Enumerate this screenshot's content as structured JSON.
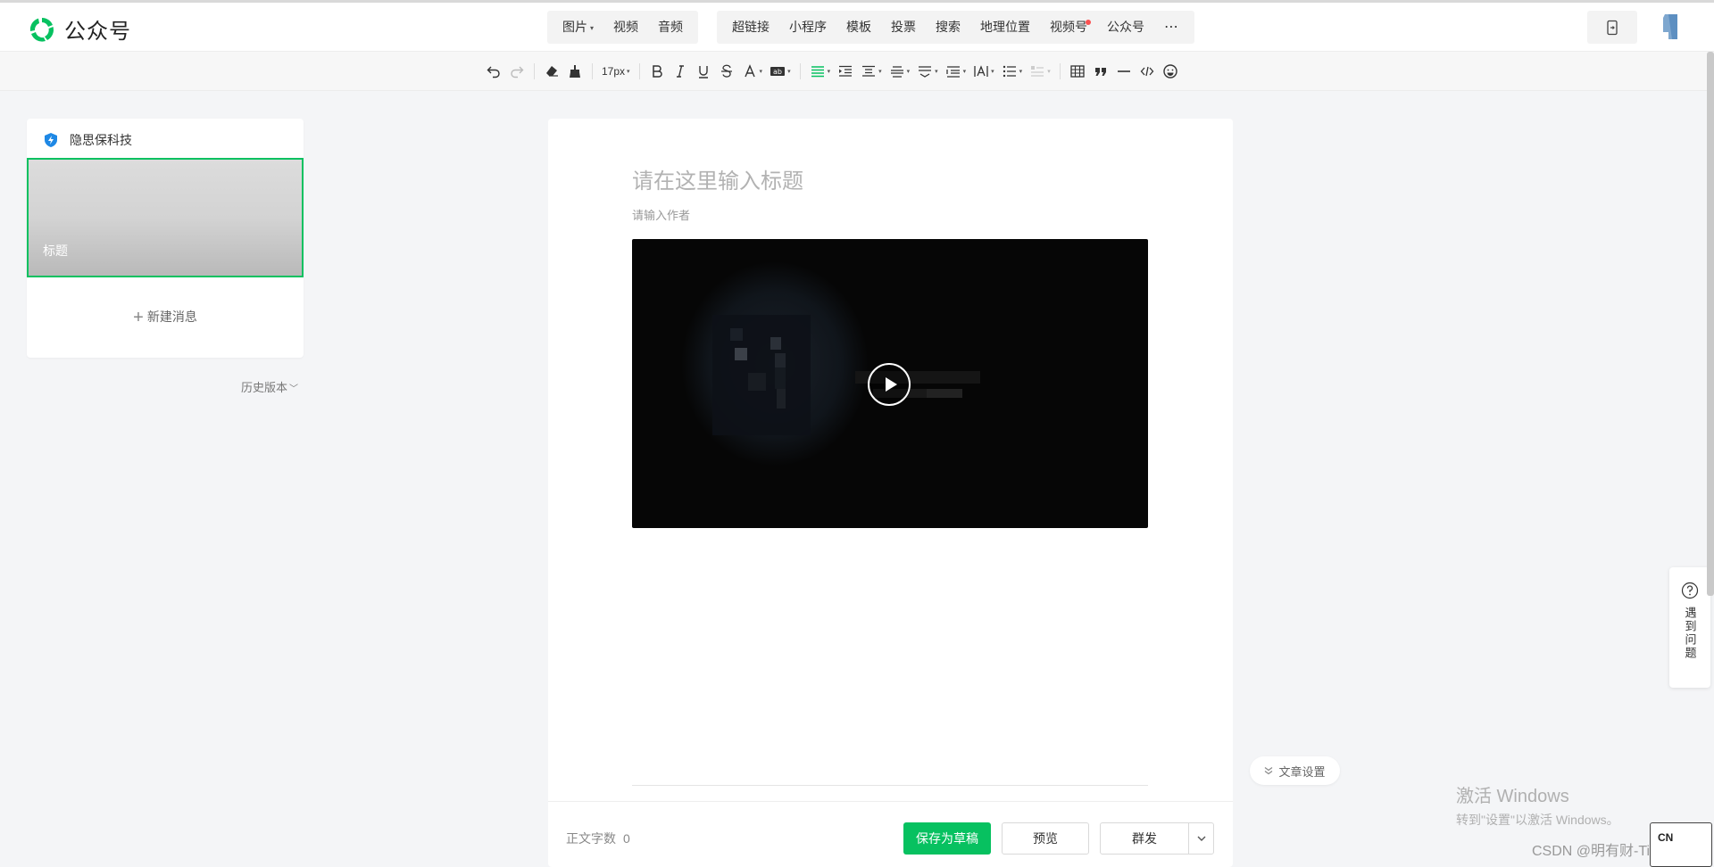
{
  "header": {
    "app_name": "公众号",
    "media_menu": [
      {
        "label": "图片",
        "has_dropdown": true
      },
      {
        "label": "视频",
        "has_dropdown": false
      },
      {
        "label": "音频",
        "has_dropdown": false
      }
    ],
    "insert_menu": [
      {
        "label": "超链接"
      },
      {
        "label": "小程序"
      },
      {
        "label": "模板"
      },
      {
        "label": "投票"
      },
      {
        "label": "搜索"
      },
      {
        "label": "地理位置"
      },
      {
        "label": "视频号",
        "badge": "red-dot"
      },
      {
        "label": "公众号"
      }
    ],
    "more_icon": "ellipsis-icon",
    "mobile_preview_icon": "phone-preview-icon"
  },
  "toolbar": {
    "font_size": "17px",
    "buttons": [
      "undo",
      "redo",
      "clear-format",
      "format-painter",
      "font-size",
      "bold",
      "italic",
      "underline",
      "strikethrough",
      "font-color",
      "background-color",
      "align",
      "indent",
      "paragraph-spacing",
      "line-height",
      "letter-spacing",
      "list-indent",
      "text-direction",
      "unordered-list",
      "ordered-list",
      "table",
      "quote",
      "horizontal-rule",
      "code",
      "emoji"
    ]
  },
  "left_panel": {
    "account_name": "隐思保科技",
    "article_thumb_title": "标题",
    "new_message": "新建消息",
    "history_version": "历史版本"
  },
  "editor": {
    "title_placeholder": "请在这里输入标题",
    "author_placeholder": "请输入作者",
    "word_count_label": "正文字数",
    "word_count": "0",
    "save_draft": "保存为草稿",
    "preview": "预览",
    "mass_send": "群发"
  },
  "right_float": {
    "article_settings": "文章设置",
    "help": "遇到问题"
  },
  "os_overlay": {
    "activate_title": "激活 Windows",
    "activate_sub": "转到\"设置\"以激活 Windows。",
    "watermark": "CSDN @明有财-Tiary",
    "ime": "CN"
  },
  "colors": {
    "brand_green": "#07c160",
    "red_badge": "#fa5151"
  }
}
